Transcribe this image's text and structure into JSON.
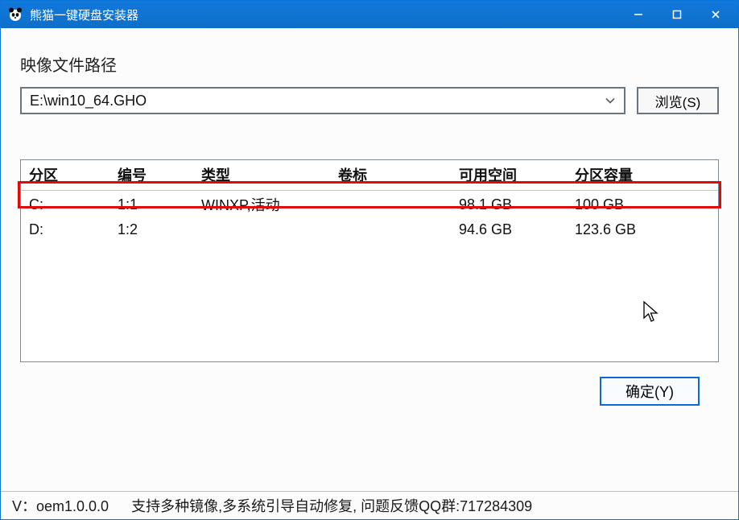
{
  "window": {
    "title": "熊猫一键硬盘安装器"
  },
  "path_section": {
    "label": "映像文件路径",
    "value": "E:\\win10_64.GHO",
    "browse_label": "浏览(S)"
  },
  "table": {
    "headers": {
      "partition": "分区",
      "index": "编号",
      "type": "类型",
      "label": "卷标",
      "free": "可用空间",
      "capacity": "分区容量"
    },
    "rows": [
      {
        "partition": "C:",
        "index": "1:1",
        "type": "WINXP,活动",
        "label": "",
        "free": "98.1 GB",
        "capacity": "100 GB"
      },
      {
        "partition": "D:",
        "index": "1:2",
        "type": "",
        "label": "",
        "free": "94.6 GB",
        "capacity": "123.6 GB"
      }
    ]
  },
  "actions": {
    "ok_label": "确定(Y)"
  },
  "footer": {
    "version": "V：oem1.0.0.0",
    "info": "支持多种镜像,多系统引导自动修复, 问题反馈QQ群:717284309"
  }
}
